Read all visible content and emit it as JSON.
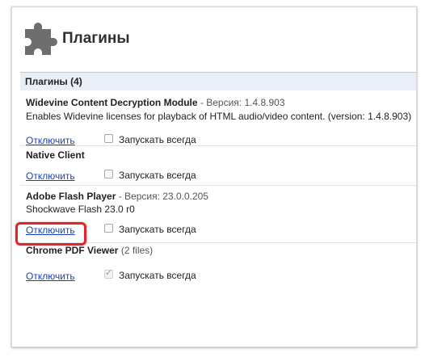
{
  "header": {
    "title": "Плагины",
    "icon": "puzzle-piece-icon"
  },
  "plugins_section": {
    "label": "Плагины (4)"
  },
  "colors": {
    "link": "#1a3fb8",
    "highlight": "#e0262b",
    "section_bar": "#eaeff7"
  },
  "plugins": [
    {
      "name": "Widevine Content Decryption Module",
      "meta": " - Версия: 1.4.8.903",
      "description": "Enables Widevine licenses for playback of HTML audio/video content. (version: 1.4.8.903)",
      "disable_label": "Отключить",
      "always_run_label": "Запускать всегда",
      "always_run_checked": false
    },
    {
      "name": "Native Client",
      "meta": "",
      "description": "",
      "disable_label": "Отключить",
      "always_run_label": "Запускать всегда",
      "always_run_checked": false
    },
    {
      "name": "Adobe Flash Player",
      "meta": " - Версия: 23.0.0.205",
      "description": "Shockwave Flash 23.0 r0",
      "disable_label": "Отключить",
      "always_run_label": "Запускать всегда",
      "always_run_checked": false
    },
    {
      "name": "Chrome PDF Viewer",
      "meta": " (2 files)",
      "description": "",
      "disable_label": "Отключить",
      "always_run_label": "Запускать всегда",
      "always_run_checked": true
    }
  ]
}
